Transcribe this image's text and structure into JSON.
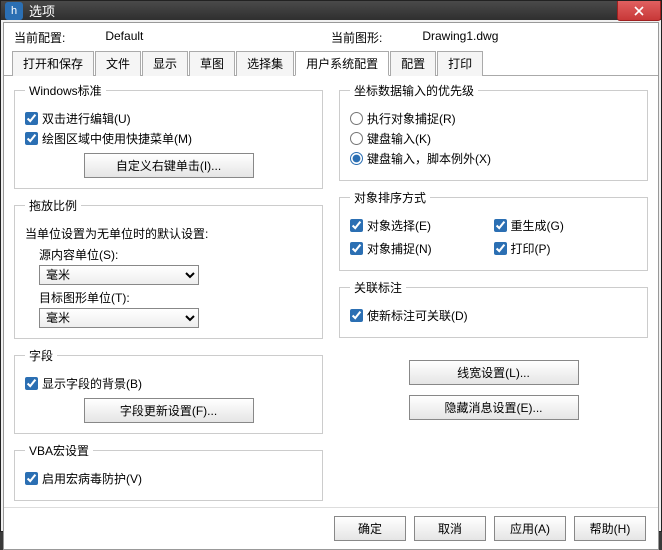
{
  "title": "选项",
  "current_config_label": "当前配置:",
  "current_config_value": "Default",
  "current_drawing_label": "当前图形:",
  "current_drawing_value": "Drawing1.dwg",
  "tabs": [
    "打开和保存",
    "文件",
    "显示",
    "草图",
    "选择集",
    "用户系统配置",
    "配置",
    "打印"
  ],
  "left": {
    "win_std": {
      "legend": "Windows标准",
      "dblclick": "双击进行编辑(U)",
      "shortcutmenu": "绘图区域中使用快捷菜单(M)",
      "custom_rclick": "自定义右键单击(I)..."
    },
    "drag_scale": {
      "legend": "拖放比例",
      "note": "当单位设置为无单位时的默认设置:",
      "src_label": "源内容单位(S):",
      "src_value": "毫米",
      "tgt_label": "目标图形单位(T):",
      "tgt_value": "毫米"
    },
    "field": {
      "legend": "字段",
      "show_bg": "显示字段的背景(B)",
      "update_btn": "字段更新设置(F)..."
    },
    "vba": {
      "legend": "VBA宏设置",
      "macro_virus": "启用宏病毒防护(V)"
    }
  },
  "right": {
    "coord_priority": {
      "legend": "坐标数据输入的优先级",
      "osnap": "执行对象捕捉(R)",
      "keyboard": "键盘输入(K)",
      "keyboard_except": "键盘输入，脚本例外(X)"
    },
    "sort": {
      "legend": "对象排序方式",
      "obj_select": "对象选择(E)",
      "regen": "重生成(G)",
      "obj_snap": "对象捕捉(N)",
      "print": "打印(P)"
    },
    "assoc": {
      "legend": "关联标注",
      "new_assoc": "使新标注可关联(D)"
    },
    "lineweight_btn": "线宽设置(L)...",
    "hide_msg_btn": "隐藏消息设置(E)..."
  },
  "footer": {
    "ok": "确定",
    "cancel": "取消",
    "apply": "应用(A)",
    "help": "帮助(H)"
  }
}
